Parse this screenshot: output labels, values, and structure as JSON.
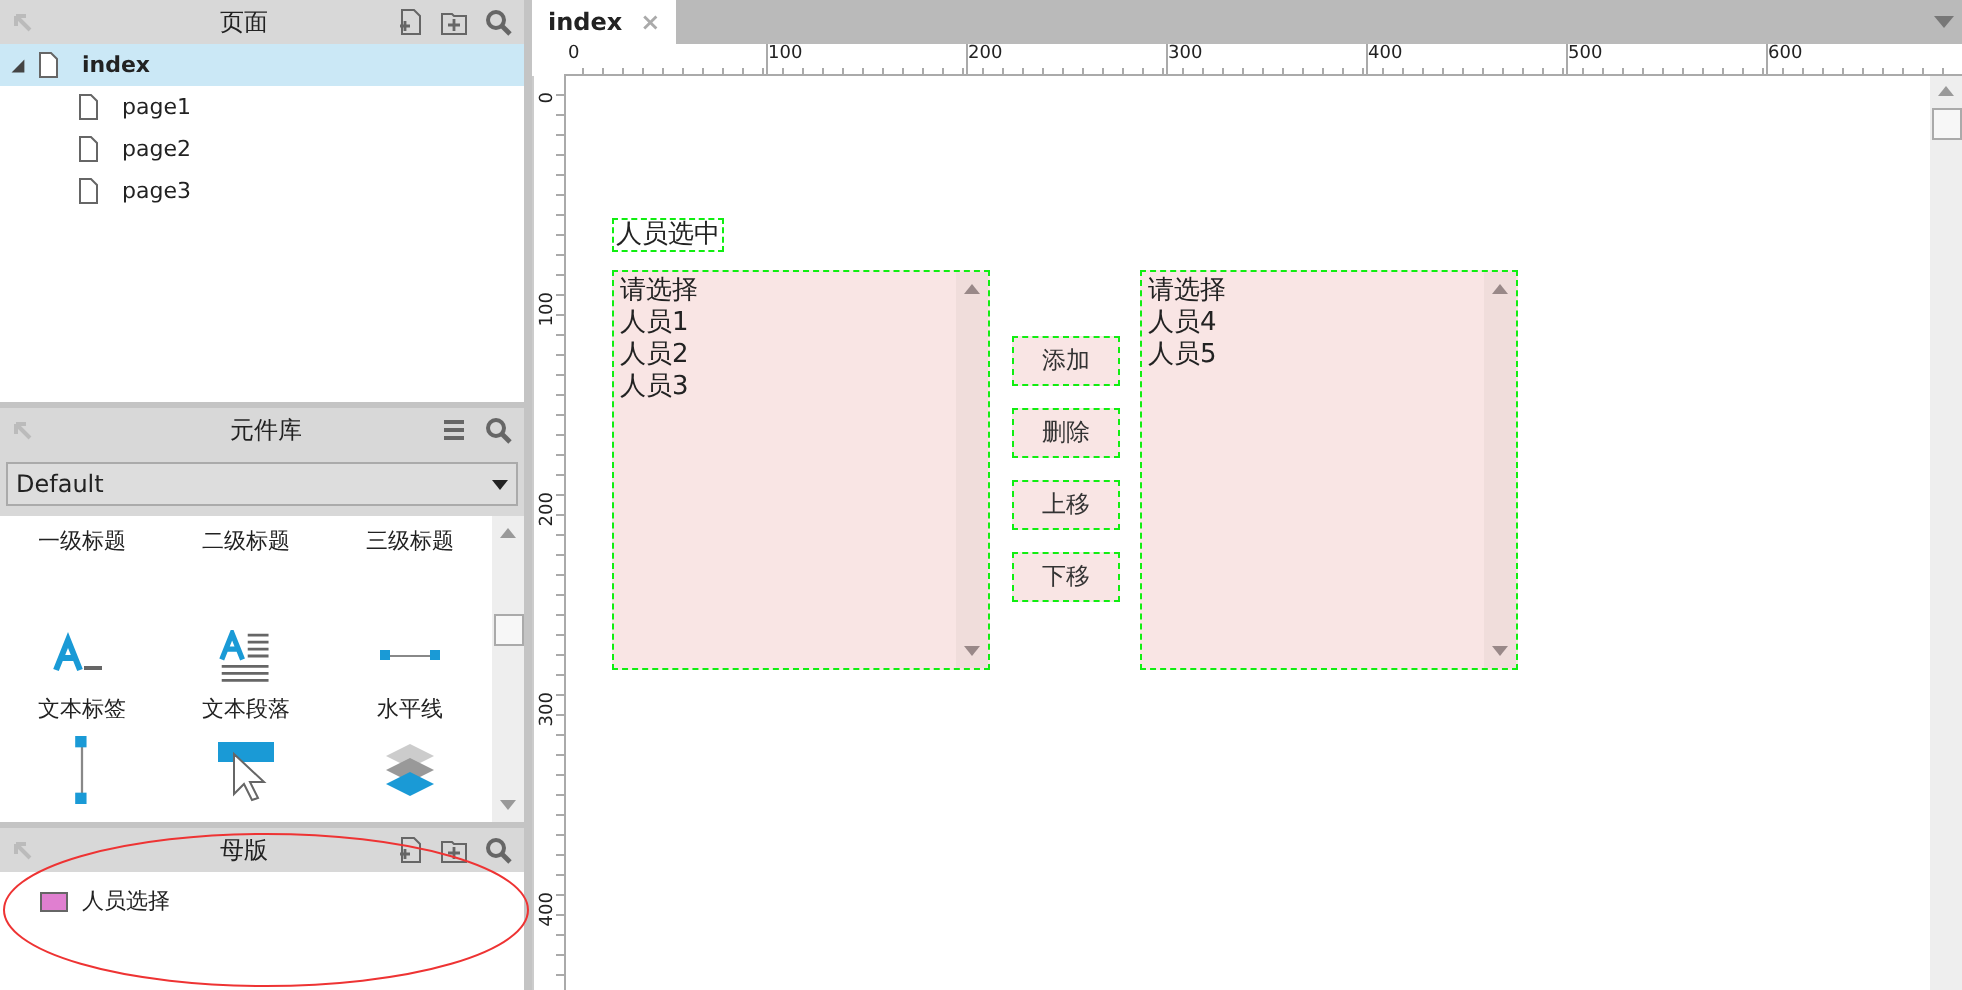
{
  "pages_panel": {
    "title": "页面",
    "tree": [
      {
        "label": "index",
        "selected": true,
        "expanded": true,
        "children": [
          {
            "label": "page1",
            "selected": false
          },
          {
            "label": "page2",
            "selected": false
          },
          {
            "label": "page3",
            "selected": false
          }
        ]
      }
    ]
  },
  "library_panel": {
    "title": "元件库",
    "library": "Default",
    "items": [
      {
        "kind": "text-only",
        "label": "一级标题"
      },
      {
        "kind": "text-only",
        "label": "二级标题"
      },
      {
        "kind": "text-only",
        "label": "三级标题"
      },
      {
        "kind": "text-label",
        "label": "文本标签"
      },
      {
        "kind": "paragraph",
        "label": "文本段落"
      },
      {
        "kind": "hline",
        "label": "水平线"
      },
      {
        "kind": "vline"
      },
      {
        "kind": "hotspot"
      },
      {
        "kind": "layers"
      }
    ]
  },
  "masters_panel": {
    "title": "母版",
    "items": [
      {
        "label": "人员选择"
      }
    ]
  },
  "tabs": [
    {
      "label": "index",
      "close": "×",
      "selected": true
    }
  ],
  "ruler": {
    "x_labels": [
      "0",
      "100",
      "200",
      "300",
      "400",
      "500",
      "600"
    ],
    "y_labels": [
      "0",
      "100",
      "200",
      "300",
      "400"
    ]
  },
  "canvas": {
    "heading": "人员选中",
    "left_list": {
      "items": [
        "请选择",
        "人员1",
        "人员2",
        "人员3"
      ]
    },
    "buttons": [
      "添加",
      "删除",
      "上移",
      "下移"
    ],
    "right_list": {
      "items": [
        "请选择",
        "人员4",
        "人员5"
      ]
    }
  }
}
